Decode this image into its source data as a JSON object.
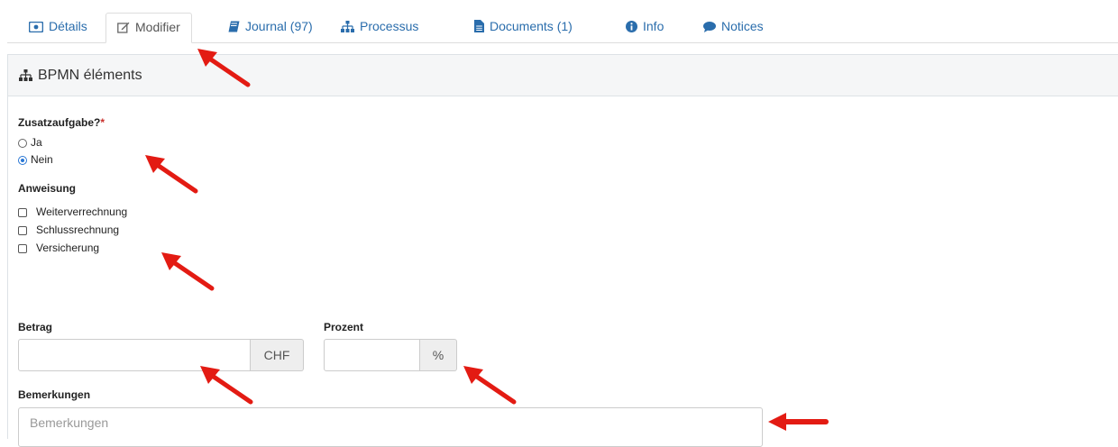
{
  "tabs": [
    {
      "label": "Détails",
      "icon": "id-card-icon"
    },
    {
      "label": "Modifier",
      "icon": "edit-icon",
      "active": true
    },
    {
      "label": "Journal (97)",
      "icon": "book-icon"
    },
    {
      "label": "Processus",
      "icon": "sitemap-icon"
    },
    {
      "label": "Documents (1)",
      "icon": "file-icon"
    },
    {
      "label": "Info",
      "icon": "info-icon"
    },
    {
      "label": "Notices",
      "icon": "comment-icon"
    }
  ],
  "panel": {
    "title": "BPMN éléments",
    "icon": "sitemap-icon"
  },
  "form": {
    "zusatz": {
      "label": "Zusatzaufgabe?",
      "required_mark": "*",
      "options": [
        "Ja",
        "Nein"
      ],
      "selected": "Nein"
    },
    "anweisung": {
      "label": "Anweisung",
      "options": [
        "Weiterverrechnung",
        "Schlussrechnung",
        "Versicherung"
      ]
    },
    "betrag": {
      "label": "Betrag",
      "value": "",
      "addon": "CHF"
    },
    "prozent": {
      "label": "Prozent",
      "value": "",
      "addon": "%"
    },
    "bemerkungen": {
      "label": "Bemerkungen",
      "placeholder": "Bemerkungen"
    }
  },
  "colors": {
    "link": "#2a6dac",
    "annotation_arrow": "#e31b13",
    "accent": "#2a77d4"
  }
}
